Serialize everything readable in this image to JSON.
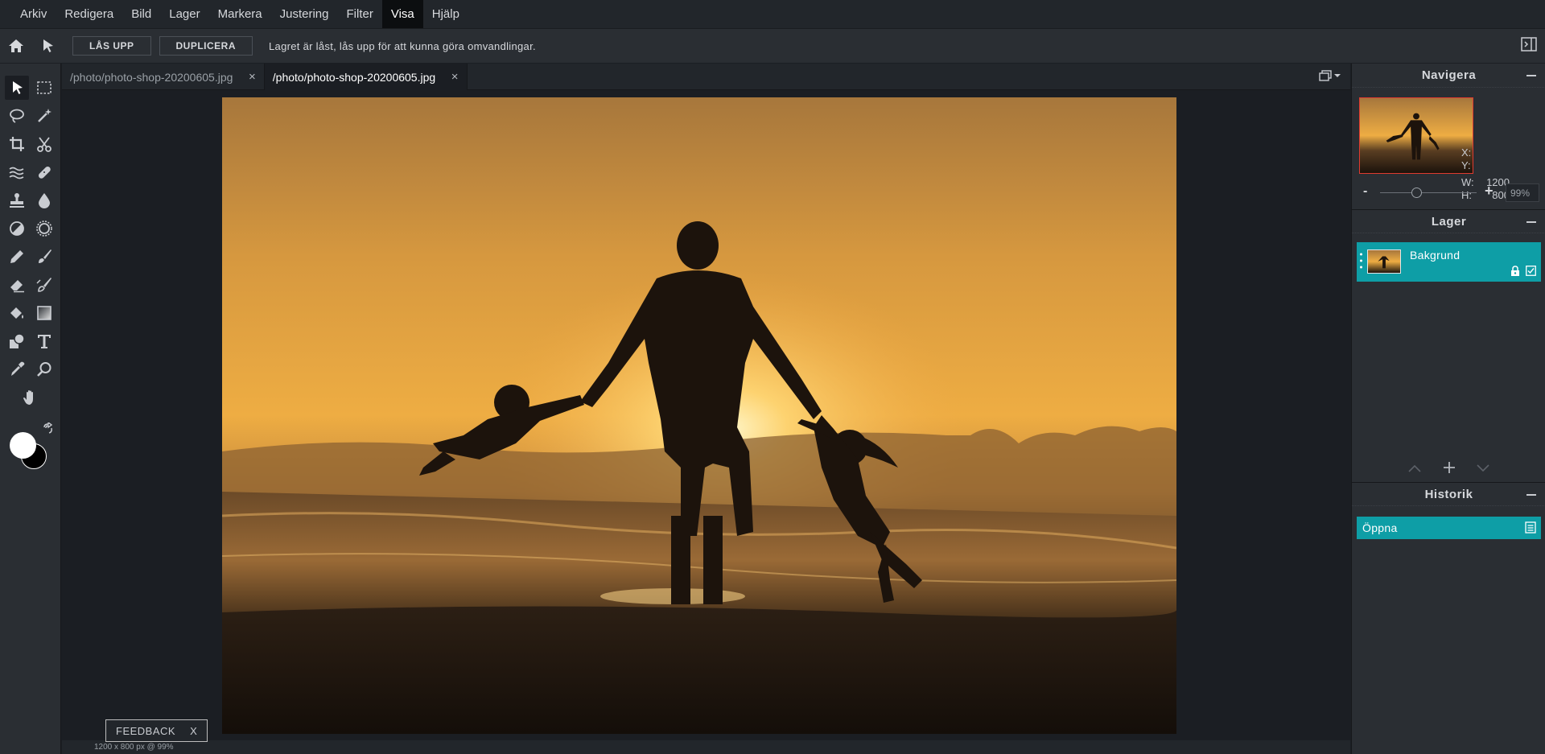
{
  "menubar": {
    "items": [
      {
        "label": "Arkiv"
      },
      {
        "label": "Redigera"
      },
      {
        "label": "Bild"
      },
      {
        "label": "Lager"
      },
      {
        "label": "Markera"
      },
      {
        "label": "Justering"
      },
      {
        "label": "Filter"
      },
      {
        "label": "Visa",
        "active": true
      },
      {
        "label": "Hjälp"
      }
    ]
  },
  "options": {
    "unlock_label": "LÅS UPP",
    "duplicate_label": "DUPLICERA",
    "message": "Lagret är låst, lås upp för att kunna göra omvandlingar."
  },
  "tabs": [
    {
      "title": "/photo/photo-shop-20200605.jpg",
      "close": "×",
      "active": false
    },
    {
      "title": "/photo/photo-shop-20200605.jpg",
      "close": "×",
      "active": true
    }
  ],
  "tools": [
    "move-icon",
    "rect-select-icon",
    "lasso-icon",
    "magic-wand-icon",
    "crop-icon",
    "scissors-icon",
    "liquify-icon",
    "bandage-icon",
    "stamp-icon",
    "blur-drop-icon",
    "dodge-icon",
    "sponge-icon",
    "pencil-icon",
    "brush-icon",
    "eraser-icon",
    "replace-color-icon",
    "bucket-icon",
    "gradient-icon",
    "shape-icon",
    "text-icon",
    "eyedropper-icon",
    "zoom-icon",
    "hand-icon"
  ],
  "colors": {
    "foreground": "#ffffff",
    "background": "#000000",
    "accent": "#0e9ea6"
  },
  "navigator": {
    "title": "Navigera",
    "x_label": "X:",
    "y_label": "Y:",
    "x_value": "",
    "y_value": "",
    "w_label": "W:",
    "h_label": "H:",
    "w_value": "1200",
    "h_value": "800",
    "zoom_minus": "-",
    "zoom_plus": "+",
    "zoom_value": "99%",
    "zoom_level": 0.38
  },
  "layers": {
    "title": "Lager",
    "items": [
      {
        "name": "Bakgrund",
        "locked": true,
        "visible": true
      }
    ]
  },
  "history": {
    "title": "Historik",
    "items": [
      {
        "name": "Öppna"
      }
    ]
  },
  "status": {
    "info": "1200 x 800 px @ 99%"
  },
  "feedback": {
    "label": "FEEDBACK",
    "close": "X"
  }
}
